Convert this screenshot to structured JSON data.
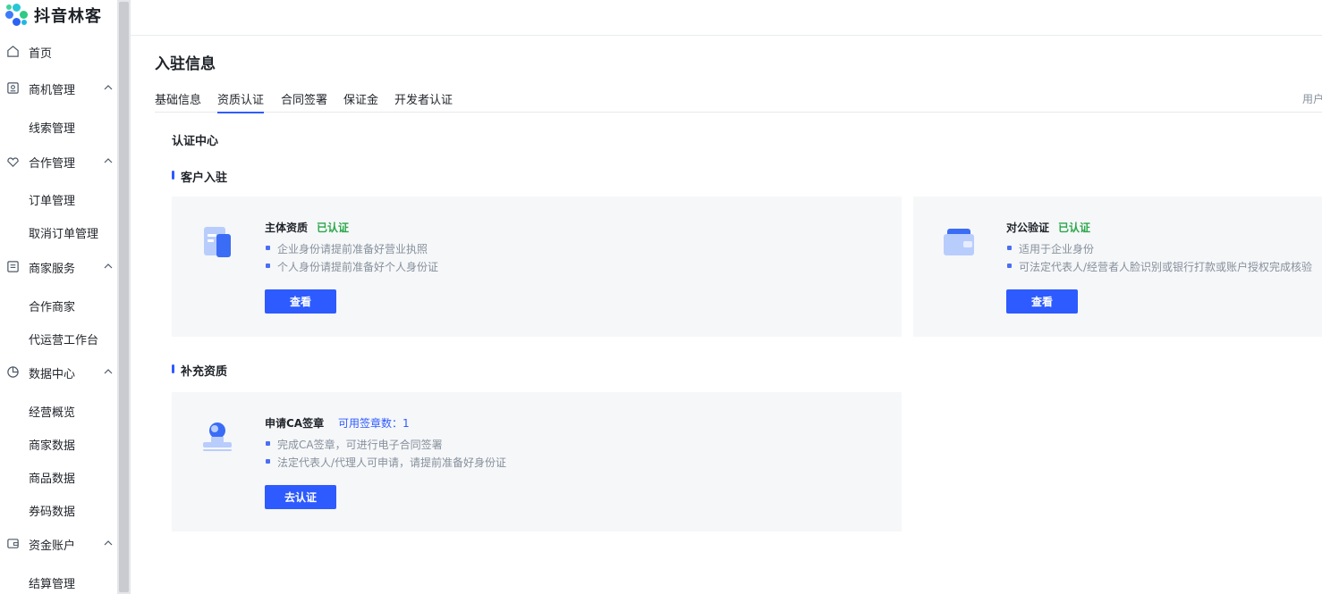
{
  "app": {
    "name": "抖音林客"
  },
  "sidebar": {
    "items": [
      {
        "label": "首页",
        "icon": "home-icon"
      },
      {
        "label": "商机管理",
        "icon": "id-card-icon",
        "children": [
          "线索管理"
        ]
      },
      {
        "label": "合作管理",
        "icon": "handshake-icon",
        "children": [
          "订单管理",
          "取消订单管理"
        ]
      },
      {
        "label": "商家服务",
        "icon": "list-icon",
        "children": [
          "合作商家",
          "代运营工作台"
        ]
      },
      {
        "label": "数据中心",
        "icon": "pie-chart-icon",
        "children": [
          "经营概览",
          "商家数据",
          "商品数据",
          "券码数据"
        ]
      },
      {
        "label": "资金账户",
        "icon": "wallet-icon",
        "children": [
          "结算管理"
        ]
      }
    ]
  },
  "page": {
    "title": "入驻信息"
  },
  "tabs": {
    "items": [
      "基础信息",
      "资质认证",
      "合同签署",
      "保证金",
      "开发者认证"
    ],
    "active": "资质认证",
    "right_text": "用户"
  },
  "center_title": "认证中心",
  "sections": {
    "onboarding": {
      "title": "客户入驻",
      "cards": [
        {
          "title": "主体资质",
          "status": "已认证",
          "bullets": [
            "企业身份请提前准备好营业执照",
            "个人身份请提前准备好个人身份证"
          ],
          "button": "查看",
          "icon": "document-icon"
        },
        {
          "title": "对公验证",
          "status": "已认证",
          "bullets": [
            "适用于企业身份",
            "可法定代表人/经营者人脸识别或银行打款或账户授权完成核验"
          ],
          "button": "查看",
          "icon": "wallet-card-icon"
        }
      ]
    },
    "supplement": {
      "title": "补充资质",
      "cards": [
        {
          "title": "申请CA签章",
          "count_label": "可用签章数：1",
          "bullets": [
            "完成CA签章，可进行电子合同签署",
            "法定代表人/代理人可申请，请提前准备好身份证"
          ],
          "button": "去认证",
          "icon": "seal-stamp-icon"
        }
      ]
    }
  },
  "colors": {
    "accent": "#2d5bff",
    "success": "#2ba84a",
    "card_bg": "#f6f7f9"
  }
}
